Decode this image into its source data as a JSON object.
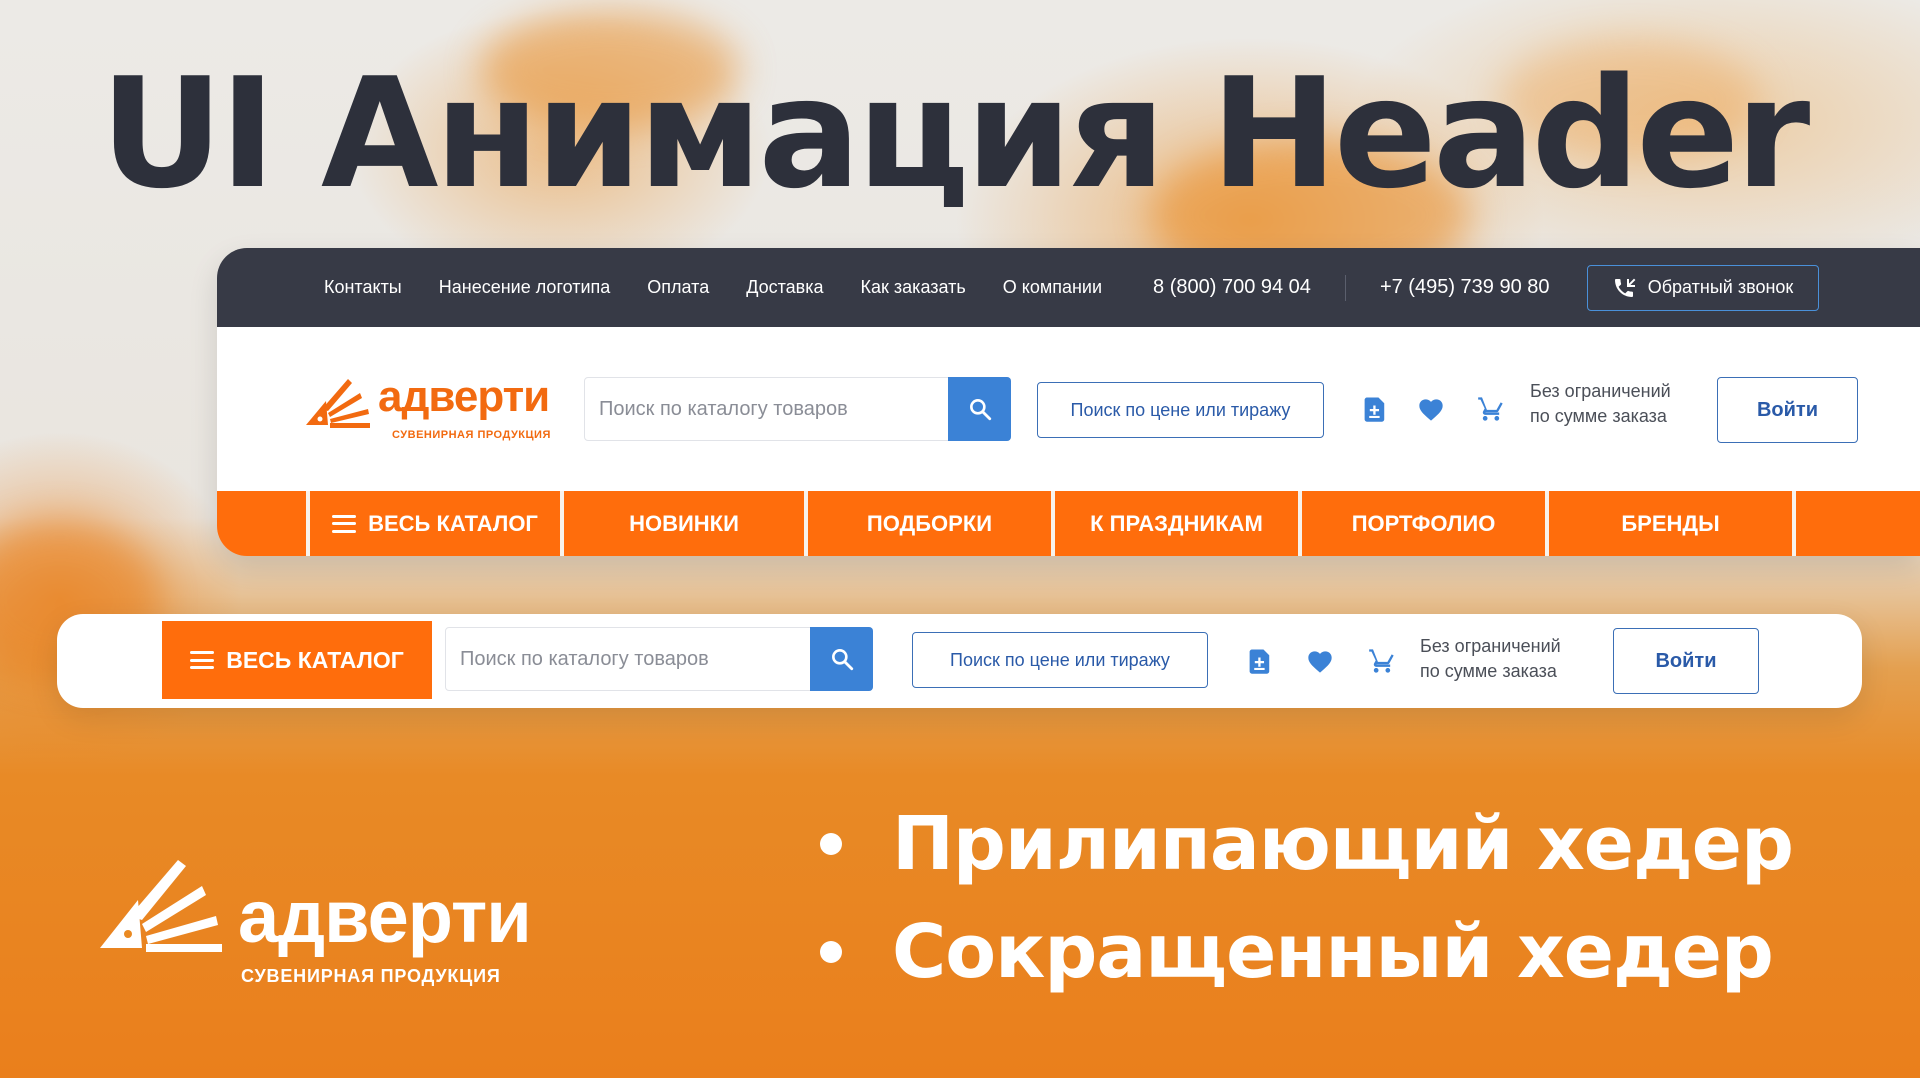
{
  "hero": {
    "title": "UI Анимация Header"
  },
  "topbar": {
    "links": [
      "Контакты",
      "Нанесение логотипа",
      "Оплата",
      "Доставка",
      "Как заказать",
      "О компании"
    ],
    "phone_1": "8 (800) 700 94 04",
    "phone_2": "+7 (495) 739 90 80",
    "callback_label": "Обратный звонок"
  },
  "brand": {
    "name": "адверти",
    "tagline": "СУВЕНИРНАЯ ПРОДУКЦИЯ",
    "color": "#f26a10"
  },
  "search": {
    "placeholder": "Поиск по каталогу товаров",
    "value": ""
  },
  "price_search_label": "Поиск по цене или тиражу",
  "order_note": {
    "line1": "Без ограничений",
    "line2": "по сумме заказа"
  },
  "login_label": "Войти",
  "catalog_nav": {
    "items": [
      "ВЕСЬ КАТАЛОГ",
      "НОВИНКИ",
      "ПОДБОРКИ",
      "К ПРАЗДНИКАМ",
      "ПОРТФОЛИО",
      "БРЕНДЫ"
    ]
  },
  "compact": {
    "catalog_label": "ВЕСЬ КАТАЛОГ"
  },
  "features": [
    "Прилипающий хедер",
    "Сокращенный хедер"
  ],
  "icons": [
    "phone-callback-icon",
    "search-icon",
    "compare-doc-icon",
    "heart-icon",
    "cart-icon",
    "burger-menu-icon"
  ],
  "colors": {
    "accent_orange": "#ff6d0c",
    "dark_bar": "#373a46",
    "primary_blue": "#3b82d6",
    "dark_text": "#2d303b"
  }
}
